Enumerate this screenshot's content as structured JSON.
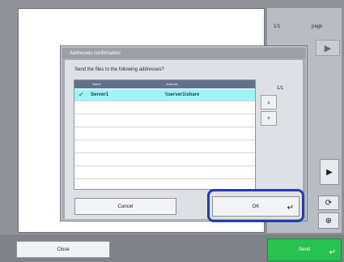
{
  "background": {
    "page_indicator": "1/1",
    "page_label": "page"
  },
  "dialog": {
    "title": "Addresses confirmation",
    "prompt": "Send the files to the following addresses?",
    "table": {
      "headers": [
        "Name",
        "Address"
      ],
      "rows": [
        {
          "name": "Server1",
          "address": "\\\\server1\\share",
          "checked": true
        }
      ]
    },
    "list_count": "1/1",
    "cancel_label": "Cancel",
    "ok_label": "OK"
  },
  "footer": {
    "close_label": "Close",
    "send_label": "Send"
  },
  "colors": {
    "selected_row": "#9ff4f4",
    "send_button": "#27c24f",
    "focus_ring": "#253ca8"
  }
}
